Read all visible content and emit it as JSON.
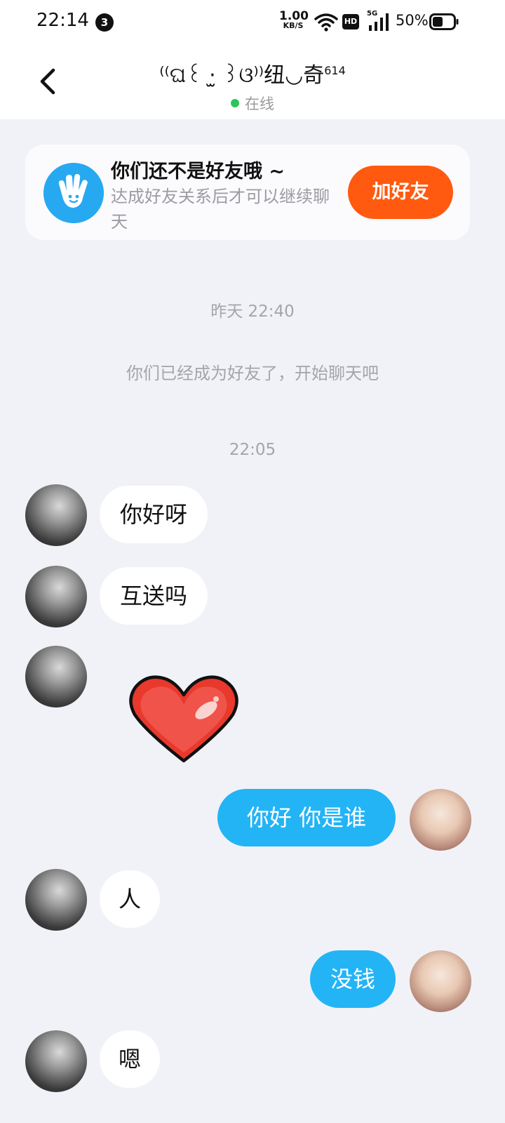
{
  "status_bar": {
    "time": "22:14",
    "notification_count": "3",
    "net_speed_value": "1.00",
    "net_speed_unit": "KB/S",
    "hd_label": "HD",
    "network_type": "5G",
    "battery_percent": "50%",
    "battery_level": 0.5
  },
  "header": {
    "title": "⁽⁽ଘ꒰ ·̫ ꒱ଓ⁾⁾纽◡奇",
    "title_sup": "614",
    "status": "在线",
    "status_color": "#2bc55a"
  },
  "friend_banner": {
    "title": "你们还不是好友哦 ~",
    "subtitle": "达成好友关系后才可以继续聊天",
    "button_label": "加好友",
    "button_color": "#ff5a0f",
    "icon": "waving-hand-icon"
  },
  "chat": {
    "timestamp_1": "昨天 22:40",
    "system_notice": "你们已经成为好友了，开始聊天吧",
    "timestamp_2": "22:05",
    "messages": [
      {
        "from": "other",
        "text": "你好呀"
      },
      {
        "from": "other",
        "text": "互送吗"
      },
      {
        "from": "other",
        "type": "sticker",
        "sticker": "heart-sticker"
      },
      {
        "from": "me",
        "text": "你好 你是谁"
      },
      {
        "from": "other",
        "text": "人"
      },
      {
        "from": "me",
        "text": "没钱"
      },
      {
        "from": "other",
        "text": "嗯"
      }
    ],
    "outgoing_color": "#23b4f6",
    "incoming_color": "#ffffff"
  }
}
